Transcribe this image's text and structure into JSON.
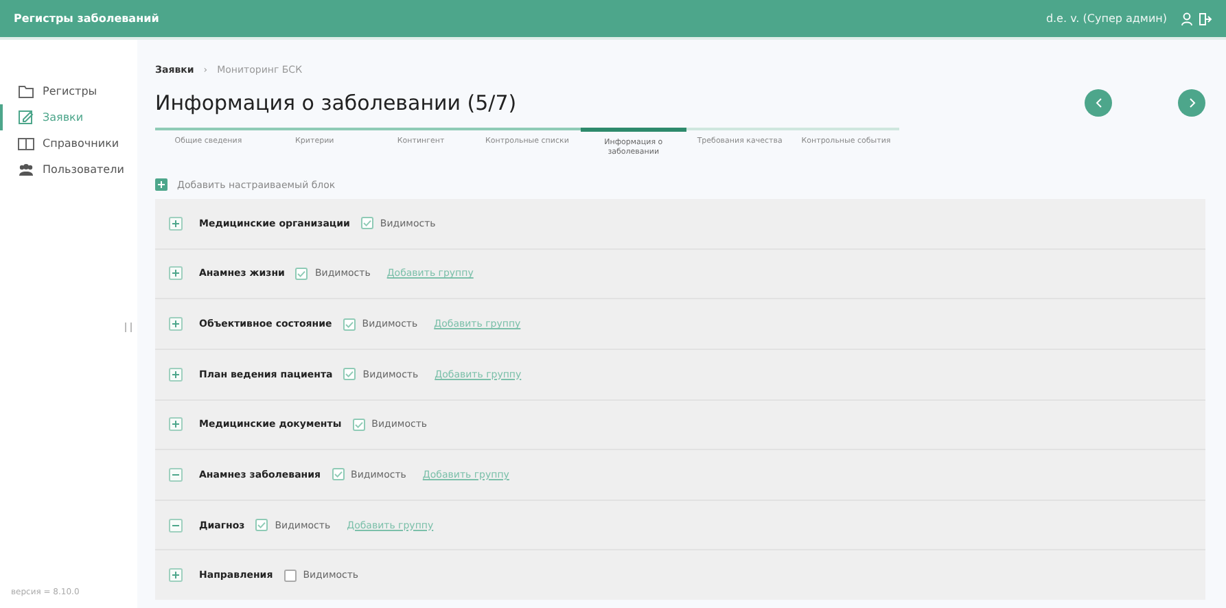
{
  "header": {
    "title": "Регистры заболеваний",
    "user": "d.e. v. (Супер админ)"
  },
  "sidebar": {
    "items": [
      {
        "label": "Регистры",
        "selected": false
      },
      {
        "label": "Заявки",
        "selected": true
      },
      {
        "label": "Справочники",
        "selected": false
      },
      {
        "label": "Пользователи",
        "selected": false
      }
    ],
    "version": "версия = 8.10.0"
  },
  "breadcrumbs": [
    "Заявки",
    "Мониторинг БСК"
  ],
  "separator": "›",
  "page_title": "Информация о заболевании (5/7)",
  "steps": [
    {
      "label": "Общие сведения",
      "completed": true,
      "selected": false
    },
    {
      "label": "Критерии",
      "completed": true,
      "selected": false
    },
    {
      "label": "Контингент",
      "completed": true,
      "selected": false
    },
    {
      "label": "Контрольные списки",
      "completed": true,
      "selected": false
    },
    {
      "label": "Информация о заболевании",
      "completed": true,
      "selected": true
    },
    {
      "label": "Требования качества",
      "completed": false,
      "selected": false
    },
    {
      "label": "Контрольные события",
      "completed": false,
      "selected": false
    }
  ],
  "add_block": "Добавить настраиваемый блок",
  "blocks": [
    {
      "title": "Медицинские организации",
      "expanded": false,
      "visibility": {
        "label": "Видимость",
        "checked": true
      }
    },
    {
      "title": "Анамнез жизни",
      "expanded": false,
      "visibility": {
        "label": "Видимость",
        "checked": true
      },
      "link": "Добавить группу"
    },
    {
      "title": "Объективное состояние",
      "expanded": false,
      "visibility": {
        "label": "Видимость",
        "checked": true
      },
      "link": "Добавить группу"
    },
    {
      "title": "План ведения пациента",
      "expanded": false,
      "visibility": {
        "label": "Видимость",
        "checked": true
      },
      "link": "Добавить группу"
    },
    {
      "title": "Медицинские документы",
      "expanded": false,
      "visibility": {
        "label": "Видимость",
        "checked": true
      }
    },
    {
      "title": "Анамнез заболевания",
      "expanded": true,
      "visibility": {
        "label": "Видимость",
        "checked": true
      },
      "link": "Добавить группу"
    },
    {
      "title": "Диагноз",
      "expanded": true,
      "visibility": {
        "label": "Видимость",
        "checked": true
      },
      "link": "Добавить группу"
    },
    {
      "title": "Направления",
      "expanded": false,
      "visibility": {
        "label": "Видимость",
        "checked": false
      }
    }
  ]
}
